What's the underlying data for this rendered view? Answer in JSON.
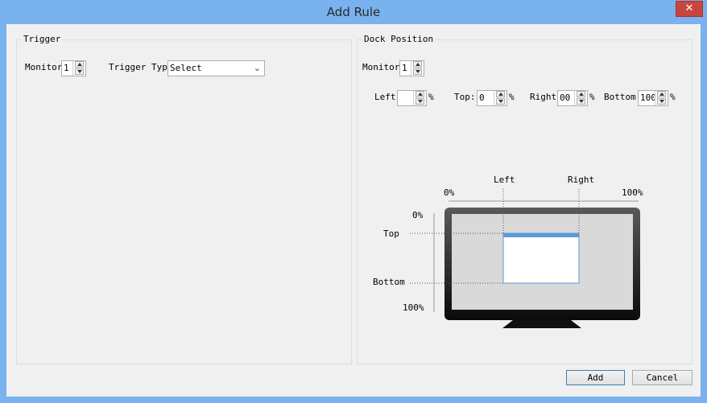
{
  "window": {
    "title": "Add Rule",
    "close_label": "✕"
  },
  "trigger": {
    "title": "Trigger",
    "monitor_label": "Monitor",
    "monitor_value": "1",
    "trigger_type_label": "Trigger Type",
    "trigger_type_value": "Select"
  },
  "dock": {
    "title": "Dock Position",
    "monitor_label": "Monitor",
    "monitor_value": "1",
    "left_label": "Left:",
    "left_value": "",
    "top_label": "Top:",
    "top_value": "0",
    "right_label": "Right:",
    "right_value": "00",
    "bottom_label": "Bottom:",
    "bottom_value": "100",
    "percent": "%"
  },
  "diagram": {
    "left_label": "Left",
    "right_label": "Right",
    "top_label": "Top",
    "bottom_label": "Bottom",
    "h_start": "0%",
    "h_end": "100%",
    "v_start": "0%",
    "v_end": "100%"
  },
  "buttons": {
    "add": "Add",
    "cancel": "Cancel"
  }
}
